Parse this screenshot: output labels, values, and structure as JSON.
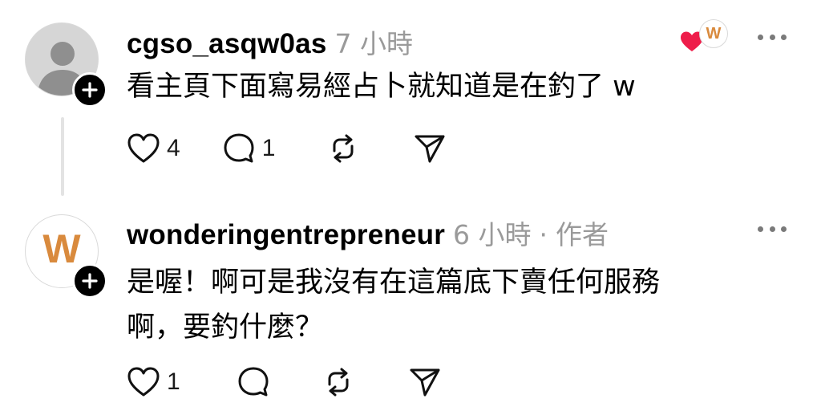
{
  "comments": [
    {
      "username": "cgso_asqw0as",
      "time": "7 小時",
      "text": "看主頁下面寫易經占卜就知道是在釣了 w",
      "likes": "4",
      "replies": "1",
      "avatar_icon": "default-person-icon"
    },
    {
      "username": "wonderingentrepreneur",
      "time": "6 小時",
      "separator": "·",
      "role": "作者",
      "text_line1": "是喔！啊可是我沒有在這篇底下賣任何服務",
      "text_line2": "啊，要釣什麼？",
      "likes": "1",
      "avatar_letter": "W"
    }
  ],
  "author_like_badge": {
    "letter": "W",
    "heart_color": "#ee1d4a"
  },
  "colors": {
    "brand": "#d98a3d",
    "meta": "#9a9a9a"
  }
}
